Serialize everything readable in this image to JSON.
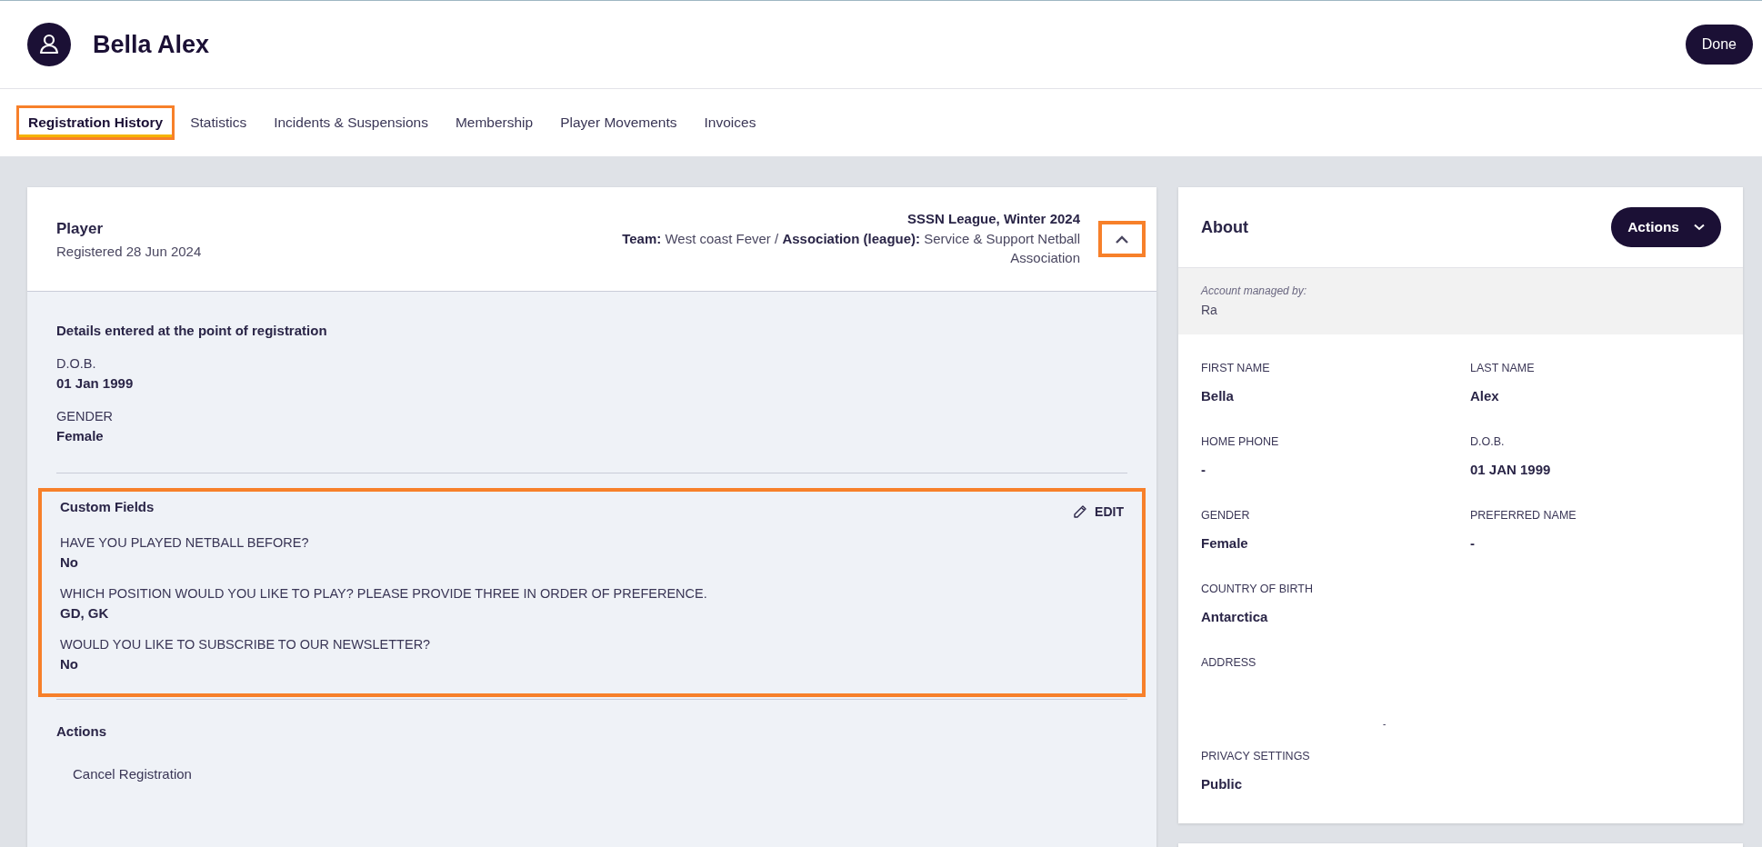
{
  "header": {
    "name": "Bella Alex",
    "done_button": "Done"
  },
  "tabs": [
    {
      "label": "Registration History",
      "selected": true,
      "highlighted": true
    },
    {
      "label": "Statistics",
      "selected": false,
      "highlighted": false
    },
    {
      "label": "Incidents & Suspensions",
      "selected": false,
      "highlighted": false
    },
    {
      "label": "Membership",
      "selected": false,
      "highlighted": false
    },
    {
      "label": "Player Movements",
      "selected": false,
      "highlighted": false
    },
    {
      "label": "Invoices",
      "selected": false,
      "highlighted": false
    }
  ],
  "registration": {
    "role": "Player",
    "registered": "Registered 28 Jun 2024",
    "competition": "SSSN League, Winter 2024",
    "team_line": "**Team:** West coast Fever / **Association (league):** Service & Support Netball Association",
    "expanded": true,
    "collapse_highlighted": true,
    "details_title": "Details entered at the point of registration",
    "details": [
      {
        "label": "D.O.B.",
        "value": "01 Jan 1999"
      },
      {
        "label": "GENDER",
        "value": "Female"
      }
    ],
    "custom_fields": {
      "title": "Custom Fields",
      "edit_button": "EDIT",
      "highlighted": true,
      "fields": [
        {
          "label": "HAVE YOU PLAYED NETBALL BEFORE?",
          "value": "No"
        },
        {
          "label": "WHICH POSITION WOULD YOU LIKE TO PLAY? PLEASE PROVIDE THREE IN ORDER OF PREFERENCE.",
          "value": "GD, GK"
        },
        {
          "label": "WOULD YOU LIKE TO SUBSCRIBE TO OUR NEWSLETTER?",
          "value": "No"
        }
      ]
    },
    "actions_title": "Actions",
    "actions": [
      "Cancel Registration"
    ]
  },
  "about": {
    "title": "About",
    "actions_button": "Actions",
    "managed_by_label": "Account managed by:",
    "managed_by": "Ra",
    "fields": [
      {
        "label": "FIRST NAME",
        "value": "Bella"
      },
      {
        "label": "LAST NAME",
        "value": "Alex"
      },
      {
        "label": "HOME PHONE",
        "value": "-"
      },
      {
        "label": "D.O.B.",
        "value": "01 JAN 1999"
      },
      {
        "label": "GENDER",
        "value": "Female"
      },
      {
        "label": "PREFERRED NAME",
        "value": "-"
      },
      {
        "label": "COUNTRY OF BIRTH",
        "value": "Antarctica"
      },
      {
        "kind": "spacer"
      },
      {
        "label": "ADDRESS",
        "value": "-",
        "kind": "address"
      },
      {
        "kind": "spacer"
      },
      {
        "label": "PRIVACY SETTINGS",
        "value": "Public"
      }
    ]
  }
}
